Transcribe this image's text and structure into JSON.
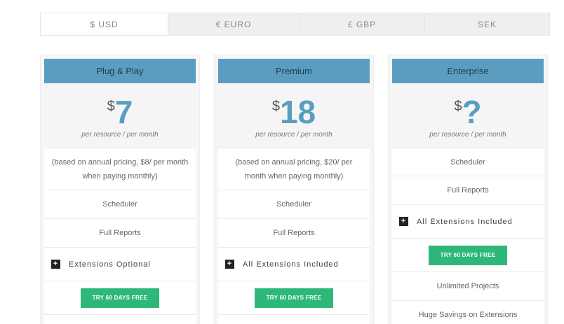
{
  "currencies": [
    {
      "label": "$ USD",
      "active": true
    },
    {
      "label": "€ EURO",
      "active": false
    },
    {
      "label": "£ GBP",
      "active": false
    },
    {
      "label": "SEK",
      "active": false
    }
  ],
  "plans": [
    {
      "name": "Plug & Play",
      "currency_symbol": "$",
      "price": "7",
      "per": "per resource / per month",
      "note": "(based on annual pricing, $8/ per month when paying monthly)",
      "features": [
        "Scheduler",
        "Full Reports"
      ],
      "extensions": "Extensions Optional",
      "cta": "TRY 60 DAYS FREE"
    },
    {
      "name": "Premium",
      "currency_symbol": "$",
      "price": "18",
      "per": "per resource / per month",
      "note": "(based on annual pricing, $20/ per month when paying monthly)",
      "features": [
        "Scheduler",
        "Full Reports"
      ],
      "extensions": "All Extensions Included",
      "cta": "TRY 60 DAYS FREE"
    },
    {
      "name": "Enterprise",
      "currency_symbol": "$",
      "price": "?",
      "per": "per resource / per month",
      "features": [
        "Scheduler",
        "Full Reports"
      ],
      "extensions": "All Extensions Included",
      "cta": "TRY 60 DAYS FREE",
      "extra_features": [
        "Unlimited Projects",
        "Huge Savings on Extensions"
      ]
    }
  ],
  "colors": {
    "header": "#5b9dc1",
    "cta": "#2db87a",
    "price": "#5b9dc1"
  },
  "icons": {
    "extension": "plus-icon"
  }
}
